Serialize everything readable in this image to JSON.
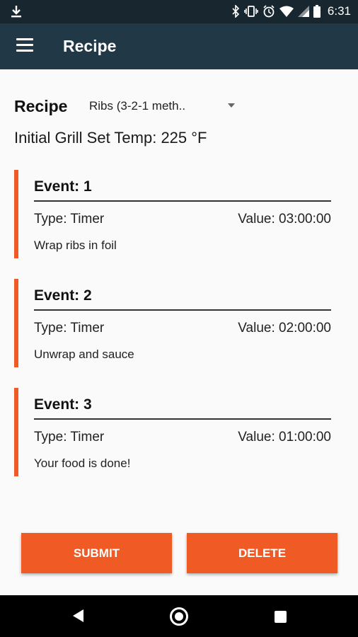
{
  "status_bar": {
    "time": "6:31"
  },
  "app_bar": {
    "title": "Recipe"
  },
  "recipe": {
    "label": "Recipe",
    "selected": "Ribs (3-2-1 meth..",
    "initial_temp": "Initial Grill Set Temp: 225 °F"
  },
  "events": [
    {
      "title": "Event: 1",
      "type": "Type: Timer",
      "value": "Value: 03:00:00",
      "description": "Wrap ribs in foil"
    },
    {
      "title": "Event: 2",
      "type": "Type: Timer",
      "value": "Value: 02:00:00",
      "description": "Unwrap and sauce"
    },
    {
      "title": "Event: 3",
      "type": "Type: Timer",
      "value": "Value: 01:00:00",
      "description": "Your food is done!"
    }
  ],
  "buttons": {
    "submit": "SUBMIT",
    "delete": "DELETE"
  },
  "colors": {
    "accent": "#f05a24",
    "app_bar": "#213846",
    "status_bar": "#18262f"
  }
}
